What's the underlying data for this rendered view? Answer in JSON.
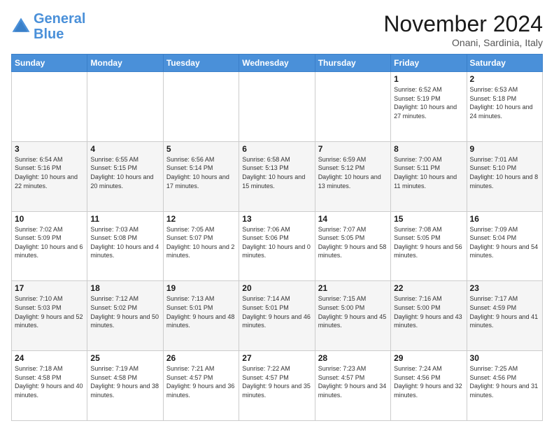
{
  "logo": {
    "line1": "General",
    "line2": "Blue"
  },
  "title": "November 2024",
  "subtitle": "Onani, Sardinia, Italy",
  "days_header": [
    "Sunday",
    "Monday",
    "Tuesday",
    "Wednesday",
    "Thursday",
    "Friday",
    "Saturday"
  ],
  "weeks": [
    [
      {
        "day": "",
        "info": ""
      },
      {
        "day": "",
        "info": ""
      },
      {
        "day": "",
        "info": ""
      },
      {
        "day": "",
        "info": ""
      },
      {
        "day": "",
        "info": ""
      },
      {
        "day": "1",
        "info": "Sunrise: 6:52 AM\nSunset: 5:19 PM\nDaylight: 10 hours and 27 minutes."
      },
      {
        "day": "2",
        "info": "Sunrise: 6:53 AM\nSunset: 5:18 PM\nDaylight: 10 hours and 24 minutes."
      }
    ],
    [
      {
        "day": "3",
        "info": "Sunrise: 6:54 AM\nSunset: 5:16 PM\nDaylight: 10 hours and 22 minutes."
      },
      {
        "day": "4",
        "info": "Sunrise: 6:55 AM\nSunset: 5:15 PM\nDaylight: 10 hours and 20 minutes."
      },
      {
        "day": "5",
        "info": "Sunrise: 6:56 AM\nSunset: 5:14 PM\nDaylight: 10 hours and 17 minutes."
      },
      {
        "day": "6",
        "info": "Sunrise: 6:58 AM\nSunset: 5:13 PM\nDaylight: 10 hours and 15 minutes."
      },
      {
        "day": "7",
        "info": "Sunrise: 6:59 AM\nSunset: 5:12 PM\nDaylight: 10 hours and 13 minutes."
      },
      {
        "day": "8",
        "info": "Sunrise: 7:00 AM\nSunset: 5:11 PM\nDaylight: 10 hours and 11 minutes."
      },
      {
        "day": "9",
        "info": "Sunrise: 7:01 AM\nSunset: 5:10 PM\nDaylight: 10 hours and 8 minutes."
      }
    ],
    [
      {
        "day": "10",
        "info": "Sunrise: 7:02 AM\nSunset: 5:09 PM\nDaylight: 10 hours and 6 minutes."
      },
      {
        "day": "11",
        "info": "Sunrise: 7:03 AM\nSunset: 5:08 PM\nDaylight: 10 hours and 4 minutes."
      },
      {
        "day": "12",
        "info": "Sunrise: 7:05 AM\nSunset: 5:07 PM\nDaylight: 10 hours and 2 minutes."
      },
      {
        "day": "13",
        "info": "Sunrise: 7:06 AM\nSunset: 5:06 PM\nDaylight: 10 hours and 0 minutes."
      },
      {
        "day": "14",
        "info": "Sunrise: 7:07 AM\nSunset: 5:05 PM\nDaylight: 9 hours and 58 minutes."
      },
      {
        "day": "15",
        "info": "Sunrise: 7:08 AM\nSunset: 5:05 PM\nDaylight: 9 hours and 56 minutes."
      },
      {
        "day": "16",
        "info": "Sunrise: 7:09 AM\nSunset: 5:04 PM\nDaylight: 9 hours and 54 minutes."
      }
    ],
    [
      {
        "day": "17",
        "info": "Sunrise: 7:10 AM\nSunset: 5:03 PM\nDaylight: 9 hours and 52 minutes."
      },
      {
        "day": "18",
        "info": "Sunrise: 7:12 AM\nSunset: 5:02 PM\nDaylight: 9 hours and 50 minutes."
      },
      {
        "day": "19",
        "info": "Sunrise: 7:13 AM\nSunset: 5:01 PM\nDaylight: 9 hours and 48 minutes."
      },
      {
        "day": "20",
        "info": "Sunrise: 7:14 AM\nSunset: 5:01 PM\nDaylight: 9 hours and 46 minutes."
      },
      {
        "day": "21",
        "info": "Sunrise: 7:15 AM\nSunset: 5:00 PM\nDaylight: 9 hours and 45 minutes."
      },
      {
        "day": "22",
        "info": "Sunrise: 7:16 AM\nSunset: 5:00 PM\nDaylight: 9 hours and 43 minutes."
      },
      {
        "day": "23",
        "info": "Sunrise: 7:17 AM\nSunset: 4:59 PM\nDaylight: 9 hours and 41 minutes."
      }
    ],
    [
      {
        "day": "24",
        "info": "Sunrise: 7:18 AM\nSunset: 4:58 PM\nDaylight: 9 hours and 40 minutes."
      },
      {
        "day": "25",
        "info": "Sunrise: 7:19 AM\nSunset: 4:58 PM\nDaylight: 9 hours and 38 minutes."
      },
      {
        "day": "26",
        "info": "Sunrise: 7:21 AM\nSunset: 4:57 PM\nDaylight: 9 hours and 36 minutes."
      },
      {
        "day": "27",
        "info": "Sunrise: 7:22 AM\nSunset: 4:57 PM\nDaylight: 9 hours and 35 minutes."
      },
      {
        "day": "28",
        "info": "Sunrise: 7:23 AM\nSunset: 4:57 PM\nDaylight: 9 hours and 34 minutes."
      },
      {
        "day": "29",
        "info": "Sunrise: 7:24 AM\nSunset: 4:56 PM\nDaylight: 9 hours and 32 minutes."
      },
      {
        "day": "30",
        "info": "Sunrise: 7:25 AM\nSunset: 4:56 PM\nDaylight: 9 hours and 31 minutes."
      }
    ]
  ]
}
